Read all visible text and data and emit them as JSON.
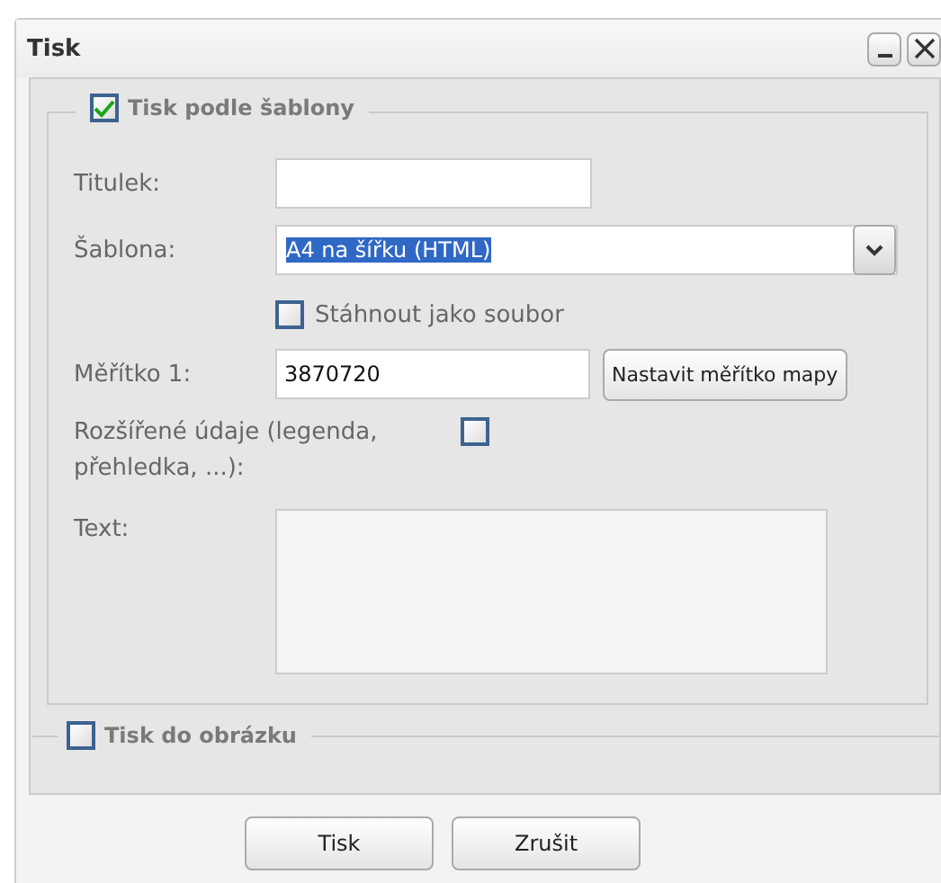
{
  "window": {
    "title": "Tisk",
    "controls": [
      {
        "kind": "minimize"
      },
      {
        "kind": "close"
      }
    ]
  },
  "template_section": {
    "label": "Tisk podle šablony",
    "checked": true,
    "fields": [
      {
        "kind": "text",
        "label": "Titulek:"
      },
      {
        "kind": "select",
        "label": "Šablona:",
        "value": "A4 na šířku (HTML)",
        "highlighted": true
      },
      {
        "kind": "checkbox",
        "label": "Stáhnout jako soubor",
        "checked": false
      },
      {
        "kind": "scale",
        "label": "Měřítko 1:",
        "value": "3870720",
        "button": "Nastavit měřítko mapy"
      },
      {
        "kind": "labeled_checkbox",
        "label": "Rozšířené údaje (legenda, přehledka, ...):",
        "checked": false
      },
      {
        "kind": "textarea",
        "label": "Text:"
      }
    ]
  },
  "image_section": {
    "label": "Tisk do obrázku",
    "checked": false
  },
  "buttons": [
    "Tisk",
    "Zrušit"
  ]
}
